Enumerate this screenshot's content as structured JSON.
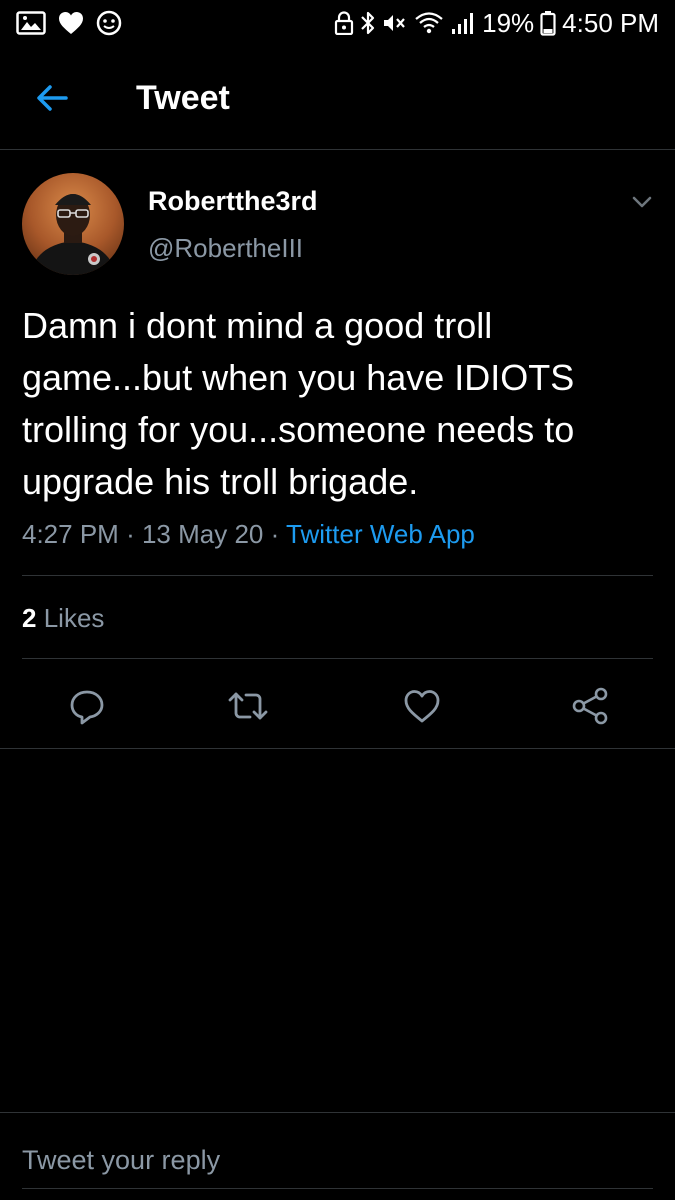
{
  "status_bar": {
    "icons_left": [
      "gallery-icon",
      "heart-icon",
      "smiley-icon"
    ],
    "icons_right": [
      "secure-icon",
      "bluetooth-icon",
      "mute-icon",
      "wifi-icon",
      "signal-icon"
    ],
    "battery": "19%",
    "time": "4:50 PM"
  },
  "header": {
    "title": "Tweet",
    "back_icon": "arrow-left-icon"
  },
  "tweet": {
    "author_name": "Robertthe3rd",
    "author_handle": "@RobertheIII",
    "text": "Damn i dont mind a good troll game...but when you have IDIOTS trolling for you...someone needs to upgrade his troll brigade.",
    "time": "4:27 PM",
    "separator": "·",
    "date": "13 May 20",
    "source": "Twitter Web App",
    "likes_count": "2",
    "likes_label": "Likes"
  },
  "actions": [
    "reply-icon",
    "retweet-icon",
    "like-icon",
    "share-icon"
  ],
  "reply": {
    "placeholder": "Tweet your reply"
  },
  "colors": {
    "background": "#000000",
    "accent": "#1d9bf0",
    "muted": "#8b98a5",
    "divider": "#2f3336"
  }
}
